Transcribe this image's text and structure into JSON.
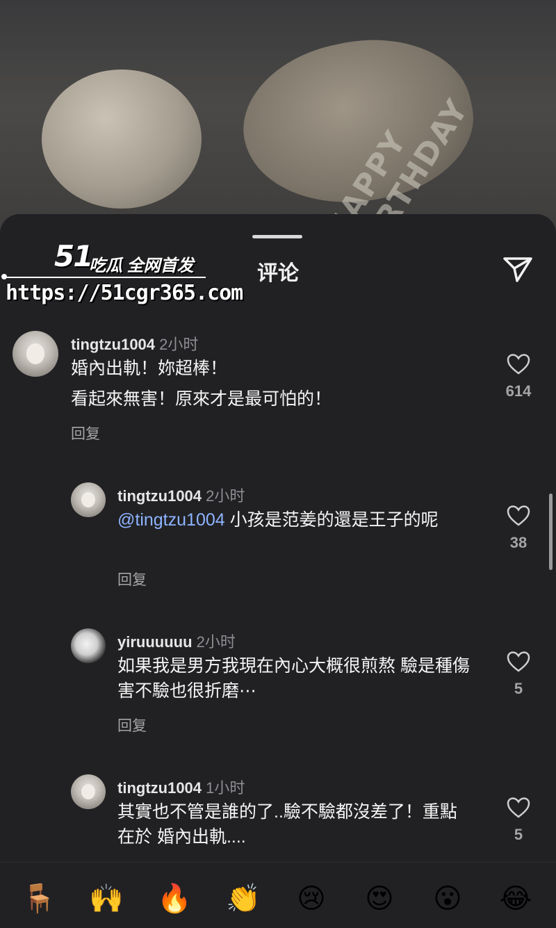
{
  "sheet": {
    "title": "评论"
  },
  "watermark": {
    "logo": "51",
    "tagline": "吃瓜 全网首发",
    "url": "https://51cgr365.com"
  },
  "photo": {
    "balloon_text": "HAPPY BIRTHDAY"
  },
  "comments": [
    {
      "user": "tingtzu1004",
      "time": "2小时",
      "lines": [
        "婚內出軌！妳超棒！",
        "看起來無害！原來才是最可怕的！"
      ],
      "reply": "回复",
      "likes": "614"
    },
    {
      "user": "tingtzu1004",
      "time": "2小时",
      "mention": "@tingtzu1004",
      "text": " 小孩是范姜的還是王子的呢",
      "reply": "回复",
      "likes": "38"
    },
    {
      "user": "yiruuuuuu",
      "time": "2小时",
      "text": "如果我是男方我現在內心大概很煎熬 驗是種傷害不驗也很折磨⋯",
      "reply": "回复",
      "likes": "5"
    },
    {
      "user": "tingtzu1004",
      "time": "1小时",
      "text": "其實也不管是誰的了..驗不驗都沒差了！重點在於 婚內出軌....",
      "likes": "5"
    }
  ],
  "emoji_bar": [
    "🪑",
    "🙌",
    "🔥",
    "👏",
    "😢",
    "😍",
    "😮",
    "😂"
  ]
}
